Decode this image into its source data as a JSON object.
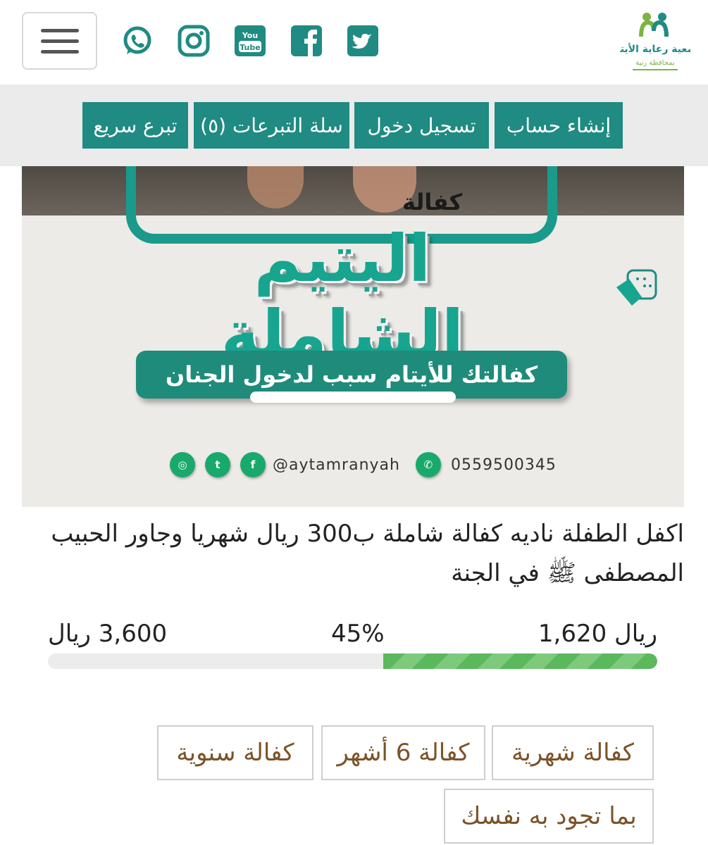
{
  "header": {
    "menu_icon": "hamburger-menu-icon",
    "social": [
      {
        "name": "whatsapp-icon"
      },
      {
        "name": "instagram-icon"
      },
      {
        "name": "youtube-icon",
        "text": "You Tube"
      },
      {
        "name": "facebook-icon"
      },
      {
        "name": "twitter-icon"
      }
    ],
    "logo_icon": "association-logo",
    "logo_text": "جمعية رعاية الأيتام",
    "logo_subtext": "بمحافظة رنية"
  },
  "nav": {
    "create_account": "إنشاء حساب",
    "login": "تسجيل دخول",
    "basket": "سلة التبرعات (٥)",
    "quick_donate": "تبرع سريع"
  },
  "banner": {
    "kafala": "كفالة",
    "title": "اليتيم الشاملة",
    "slogan": "كفالتك للأيتام سبب لدخول الجنان",
    "handle": "@aytamranyah",
    "phone": "0559500345"
  },
  "description": "اكفل الطفلة ناديه كفالة شاملة ب300 ريال شهريا وجاور الحبيب المصطفى ﷺ في الجنة",
  "progress": {
    "collected": "1,620 ريال",
    "percent_label": "45%",
    "target": "3,600 ريال",
    "percent": 45
  },
  "options": {
    "monthly": "كفالة شهرية",
    "six_months": "كفالة 6 أشهر",
    "yearly": "كفالة سنوية",
    "custom": "بما تجود به نفسك"
  },
  "colors": {
    "teal": "#1f8b82",
    "progress_green": "#5cb85c",
    "option_text": "#7b5328"
  }
}
